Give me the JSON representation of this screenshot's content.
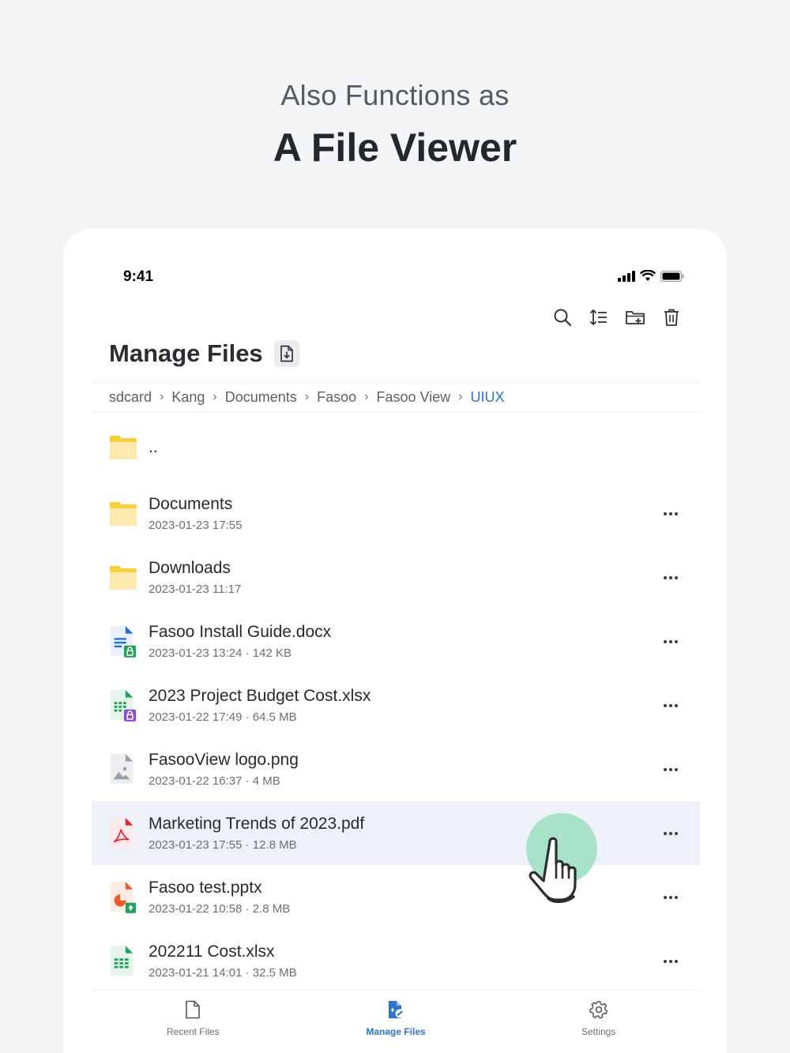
{
  "hero": {
    "subtitle": "Also Functions as",
    "title": "A File Viewer"
  },
  "status_bar": {
    "time": "9:41",
    "icons": [
      "signal-icon",
      "wifi-icon",
      "battery-icon"
    ]
  },
  "toolbar": {
    "icons": [
      "search-icon",
      "sort-icon",
      "new-folder-icon",
      "trash-icon"
    ]
  },
  "page": {
    "title": "Manage Files",
    "title_badge_icon": "file-download-icon"
  },
  "breadcrumb": [
    "sdcard",
    "Kang",
    "Documents",
    "Fasoo",
    "Fasoo View",
    "UIUX"
  ],
  "files": [
    {
      "name": "..",
      "date": "",
      "size": "",
      "icon": "folder-icon"
    },
    {
      "name": "Documents",
      "date": "2023-01-23",
      "time": "17:55",
      "size": "",
      "icon": "folder-icon"
    },
    {
      "name": "Downloads",
      "date": "2023-01-23",
      "time": "11:17",
      "size": "",
      "icon": "folder-icon"
    },
    {
      "name": "Fasoo Install Guide.docx",
      "date": "2023-01-23",
      "time": "13:24",
      "size": "142 KB",
      "icon": "docx-locked-icon"
    },
    {
      "name": "2023 Project Budget Cost.xlsx",
      "date": "2023-01-22",
      "time": "17:49",
      "size": "64.5 MB",
      "icon": "xlsx-locked-icon"
    },
    {
      "name": "FasooView logo.png",
      "date": "2023-01-22",
      "time": "16:37",
      "size": "4 MB",
      "icon": "image-file-icon"
    },
    {
      "name": "Marketing Trends of 2023.pdf",
      "date": "2023-01-23",
      "time": "17:55",
      "size": "12.8 MB",
      "icon": "pdf-icon"
    },
    {
      "name": "Fasoo test.pptx",
      "date": "2023-01-22",
      "time": "10:58",
      "size": "2.8 MB",
      "icon": "pptx-icon"
    },
    {
      "name": "202211 Cost.xlsx",
      "date": "2023-01-21",
      "time": "14:01",
      "size": "32.5 MB",
      "icon": "xlsx-icon"
    }
  ],
  "meta_text": {
    "documents": "2023-01-23  17:55",
    "downloads": "2023-01-23  11:17",
    "docx": "2023-01-23  13:24 · 142 KB",
    "budget": "2023-01-22  17:49 · 64.5 MB",
    "png": "2023-01-22  16:37 · 4 MB",
    "pdf": "2023-01-23  17:55 · 12.8 MB",
    "pptx": "2023-01-22  10:58 · 2.8 MB",
    "cost": "2023-01-21  14:01 · 32.5 MB"
  },
  "bottom_nav": [
    {
      "label": "Recent Files",
      "icon": "file-icon"
    },
    {
      "label": "Manage Files",
      "icon": "manage-files-icon"
    },
    {
      "label": "Settings",
      "icon": "gear-icon"
    }
  ],
  "colors": {
    "accent": "#2f74c8",
    "folder": "#f5cf3c",
    "highlight_row": "#eef2f8",
    "touch_indicator": "#a8e3c9"
  }
}
